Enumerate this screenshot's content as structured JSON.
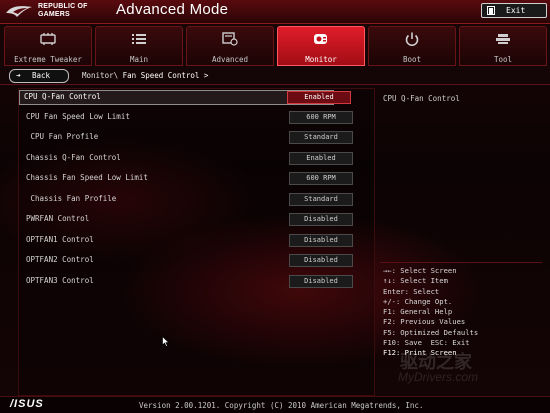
{
  "header": {
    "brand_line1": "REPUBLIC OF",
    "brand_line2": "GAMERS",
    "title": "Advanced Mode",
    "exit_label": "Exit"
  },
  "tabs": [
    {
      "label": "Extreme Tweaker",
      "icon": "extreme-tweaker-icon",
      "active": false
    },
    {
      "label": "Main",
      "icon": "list-icon",
      "active": false
    },
    {
      "label": "Advanced",
      "icon": "advanced-icon",
      "active": false
    },
    {
      "label": "Monitor",
      "icon": "monitor-gauge-icon",
      "active": true
    },
    {
      "label": "Boot",
      "icon": "power-icon",
      "active": false
    },
    {
      "label": "Tool",
      "icon": "tool-icon",
      "active": false
    }
  ],
  "nav": {
    "back_label": "Back",
    "breadcrumb_parent": "Monitor\\",
    "breadcrumb_current": "Fan Speed Control >"
  },
  "settings": [
    {
      "name": "CPU Q-Fan Control",
      "value": "Enabled",
      "selected": true
    },
    {
      "name": "CPU Fan Speed Low Limit",
      "value": "600 RPM",
      "selected": false
    },
    {
      "name": " CPU Fan Profile",
      "value": "Standard",
      "selected": false
    },
    {
      "name": "Chassis Q-Fan Control",
      "value": "Enabled",
      "selected": false
    },
    {
      "name": "Chassis Fan Speed Low Limit",
      "value": "600 RPM",
      "selected": false
    },
    {
      "name": " Chassis Fan Profile",
      "value": "Standard",
      "selected": false
    },
    {
      "name": "PWRFAN Control",
      "value": "Disabled",
      "selected": false
    },
    {
      "name": "OPTFAN1 Control",
      "value": "Disabled",
      "selected": false
    },
    {
      "name": "OPTFAN2 Control",
      "value": "Disabled",
      "selected": false
    },
    {
      "name": "OPTFAN3 Control",
      "value": "Disabled",
      "selected": false
    }
  ],
  "help": {
    "description": "CPU Q-Fan Control",
    "keys": [
      "→←: Select Screen",
      "↑↓: Select Item",
      "Enter: Select",
      "+/-: Change Opt.",
      "F1: General Help",
      "F2: Previous Values",
      "F5: Optimized Defaults",
      "F10: Save  ESC: Exit",
      "F12: Print Screen"
    ]
  },
  "footer": {
    "brand": "/ISUS",
    "version": "Version 2.00.1201. Copyright (C) 2010 American Megatrends, Inc."
  },
  "watermark": {
    "line1": "驱动之家",
    "line2": "MyDrivers.com"
  },
  "colors": {
    "accent": "#d81b25",
    "header_bg": "#4a080c",
    "selected_value_bg": "#6d0b12"
  }
}
